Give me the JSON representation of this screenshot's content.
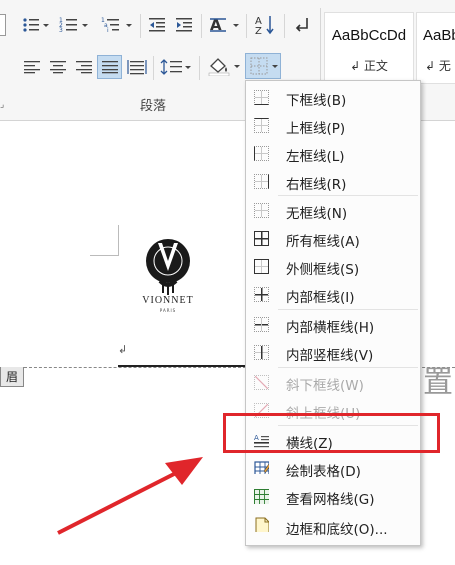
{
  "ribbon": {
    "paragraph_group_label": "段落",
    "sort_label": "A↓Z",
    "styles": [
      {
        "sample": "AaBbCcDd",
        "name": "↲ 正文"
      },
      {
        "sample": "AaBb",
        "name": "↲ 无"
      }
    ]
  },
  "document": {
    "logo_text": "VIONNET",
    "logo_subtext": "PARIS",
    "return_mark": "↲",
    "header_tab_label": "眉",
    "cut_text": "置"
  },
  "border_menu": {
    "items": [
      {
        "label": "下框线(B)",
        "icon": "bottom-border-icon",
        "enabled": true
      },
      {
        "label": "上框线(P)",
        "icon": "top-border-icon",
        "enabled": true
      },
      {
        "label": "左框线(L)",
        "icon": "left-border-icon",
        "enabled": true
      },
      {
        "label": "右框线(R)",
        "icon": "right-border-icon",
        "enabled": true
      },
      {
        "label": "无框线(N)",
        "icon": "no-border-icon",
        "enabled": true
      },
      {
        "label": "所有框线(A)",
        "icon": "all-borders-icon",
        "enabled": true
      },
      {
        "label": "外侧框线(S)",
        "icon": "outside-borders-icon",
        "enabled": true
      },
      {
        "label": "内部框线(I)",
        "icon": "inside-borders-icon",
        "enabled": true
      },
      {
        "label": "内部横框线(H)",
        "icon": "inside-horizontal-border-icon",
        "enabled": true
      },
      {
        "label": "内部竖框线(V)",
        "icon": "inside-vertical-border-icon",
        "enabled": true
      },
      {
        "label": "斜下框线(W)",
        "icon": "diagonal-down-border-icon",
        "enabled": false
      },
      {
        "label": "斜上框线(U)",
        "icon": "diagonal-up-border-icon",
        "enabled": false
      },
      {
        "label": "横线(Z)",
        "icon": "horizontal-line-icon",
        "enabled": true
      },
      {
        "label": "绘制表格(D)",
        "icon": "draw-table-icon",
        "enabled": true
      },
      {
        "label": "查看网格线(G)",
        "icon": "view-gridlines-icon",
        "enabled": true
      },
      {
        "label": "边框和底纹(O)...",
        "icon": "borders-shading-icon",
        "enabled": true
      }
    ]
  },
  "annotation": {
    "highlight_color": "#e0262b",
    "arrow_color": "#e0262b"
  }
}
